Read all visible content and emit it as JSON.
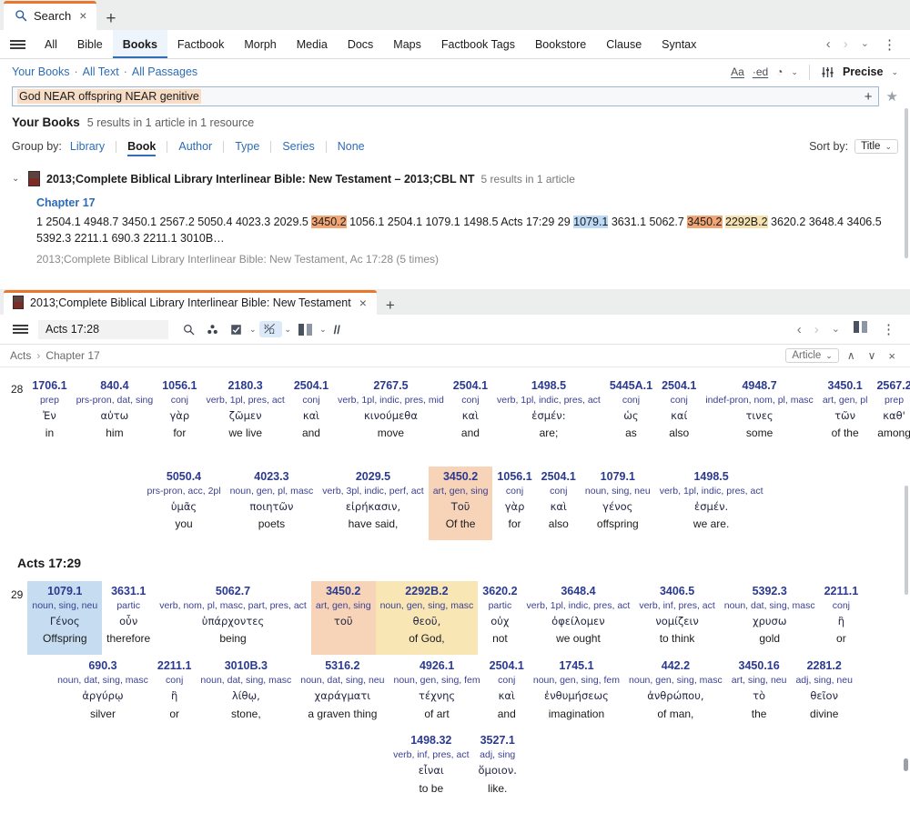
{
  "browser": {
    "tab": {
      "label": "Search",
      "icon": "search-icon",
      "close": "×"
    },
    "new_tab": "+"
  },
  "nav": {
    "menu_icon": "hamburger-icon",
    "items": [
      {
        "label": "All",
        "active": false
      },
      {
        "label": "Bible",
        "active": false
      },
      {
        "label": "Books",
        "active": true
      },
      {
        "label": "Factbook",
        "active": false
      },
      {
        "label": "Morph",
        "active": false
      },
      {
        "label": "Media",
        "active": false
      },
      {
        "label": "Docs",
        "active": false
      },
      {
        "label": "Maps",
        "active": false
      },
      {
        "label": "Factbook Tags",
        "active": false
      },
      {
        "label": "Bookstore",
        "active": false
      },
      {
        "label": "Clause",
        "active": false
      },
      {
        "label": "Syntax",
        "active": false
      }
    ],
    "back": "‹",
    "forward": "›",
    "history_caret": "⌄",
    "kebab": "⋮"
  },
  "breadcrumbs": {
    "items": [
      "Your Books",
      "All Text",
      "All Passages"
    ],
    "separator": "·",
    "tools": {
      "font_size": "Aa",
      "ed_forms": "·ed",
      "history": "◔",
      "history_caret": "⌄",
      "sliders": "♩"
    },
    "match_mode": {
      "label": "Precise",
      "caret": "⌄"
    }
  },
  "search": {
    "query": "God NEAR offspring NEAR genitive",
    "add_button": "+",
    "favorite": "★"
  },
  "results": {
    "title": "Your Books",
    "count": "5 results in 1 article in 1 resource",
    "group_by_label": "Group by:",
    "group_by": [
      {
        "label": "Library",
        "active": false
      },
      {
        "label": "Book",
        "active": true
      },
      {
        "label": "Author",
        "active": false
      },
      {
        "label": "Type",
        "active": false
      },
      {
        "label": "Series",
        "active": false
      },
      {
        "label": "None",
        "active": false
      }
    ],
    "sort_label": "Sort by:",
    "sort_value": "Title",
    "sort_caret": "⌄",
    "book": {
      "expand": "⌄",
      "title": "2013;Complete Biblical Library Interlinear Bible: New Testament – 2013;CBL NT",
      "meta": "5 results in 1 article"
    },
    "chapter_link": "Chapter 17",
    "snippet_parts": [
      {
        "t": "1 2504.1 4948.7 3450.1 2567.2 5050.4 4023.3 2029.5 ",
        "hl": ""
      },
      {
        "t": "3450.2",
        "hl": "orange"
      },
      {
        "t": " 1056.1 2504.1 1079.1 1498.5 Acts 17:29 29 ",
        "hl": ""
      },
      {
        "t": "1079.1",
        "hl": "blue"
      },
      {
        "t": " 3631.1 5062.7 ",
        "hl": ""
      },
      {
        "t": "3450.2",
        "hl": "orange"
      },
      {
        "t": " ",
        "hl": ""
      },
      {
        "t": "2292B.2",
        "hl": "yellow"
      },
      {
        "t": " 3620.2 3648.4 3406.5 5392.3 2211.1 690.3 2211.1 3010B…",
        "hl": ""
      }
    ],
    "snippet_meta": "2013;Complete Biblical Library Interlinear Bible: New Testament, Ac 17:28 (5 times)"
  },
  "panel2": {
    "tab": {
      "label": "2013;Complete Biblical Library Interlinear Bible: New Testament",
      "close": "×"
    },
    "new_tab": "+",
    "menu_icon": "hamburger-icon",
    "reference": "Acts 17:28",
    "toolbar_icons": [
      {
        "name": "search-icon",
        "glyph": "⌕",
        "active": false,
        "caret": ""
      },
      {
        "name": "parallel-resources-icon",
        "glyph": "∴",
        "active": false,
        "caret": ""
      },
      {
        "name": "visual-filters-icon",
        "glyph": "☑",
        "active": false,
        "caret": "⌄"
      },
      {
        "name": "interlinear-icon",
        "glyph": "ℵΩ",
        "active": true,
        "caret": "⌄"
      },
      {
        "name": "columns-icon",
        "glyph": "▐▌",
        "active": false,
        "caret": "⌄"
      },
      {
        "name": "parallel-slashes-icon",
        "glyph": "//",
        "active": false,
        "caret": ""
      }
    ],
    "back": "‹",
    "forward": "›",
    "caret": "⌄",
    "split_icon": "split-panel-icon",
    "kebab": "⋮",
    "breadcrumb": {
      "book": "Acts",
      "arrow": "›",
      "chapter": "Chapter 17"
    },
    "find_scope": "Article",
    "find_caret": "⌄",
    "find_up": "∧",
    "find_down": "∨",
    "find_close": "×"
  },
  "interlinear": {
    "verse28_number": "28",
    "verse29_header": "Acts 17:29",
    "verse29_number": "29",
    "rows": [
      {
        "id": "v28-line1",
        "verse": "28",
        "words": [
          {
            "num": "1706.1",
            "morph": "prep",
            "grk": "Ἐν",
            "eng": "in",
            "hl": ""
          },
          {
            "num": "840.4",
            "morph": "prs-pron, dat, sing",
            "grk": "αὐτω",
            "eng": "him",
            "hl": ""
          },
          {
            "num": "1056.1",
            "morph": "conj",
            "grk": "γὰρ",
            "eng": "for",
            "hl": ""
          },
          {
            "num": "2180.3",
            "morph": "verb, 1pl, pres, act",
            "grk": "ζῶμεν",
            "eng": "we live",
            "hl": ""
          },
          {
            "num": "2504.1",
            "morph": "conj",
            "grk": "καὶ",
            "eng": "and",
            "hl": ""
          },
          {
            "num": "2767.5",
            "morph": "verb, 1pl, indic, pres, mid",
            "grk": "κινούμεθα",
            "eng": "move",
            "hl": ""
          },
          {
            "num": "2504.1",
            "morph": "conj",
            "grk": "καὶ",
            "eng": "and",
            "hl": ""
          },
          {
            "num": "1498.5",
            "morph": "verb, 1pl, indic, pres, act",
            "grk": "ἐσμέν:",
            "eng": "are;",
            "hl": ""
          },
          {
            "num": "5445A.1",
            "morph": "conj",
            "grk": "ὡς",
            "eng": "as",
            "hl": ""
          },
          {
            "num": "2504.1",
            "morph": "conj",
            "grk": "καί",
            "eng": "also",
            "hl": ""
          },
          {
            "num": "4948.7",
            "morph": "indef-pron, nom, pl, masc",
            "grk": "τινες",
            "eng": "some",
            "hl": ""
          },
          {
            "num": "3450.1",
            "morph": "art, gen, pl",
            "grk": "τῶν",
            "eng": "of the",
            "hl": ""
          },
          {
            "num": "2567.2",
            "morph": "prep",
            "grk": "καθ'",
            "eng": "among",
            "hl": ""
          }
        ]
      },
      {
        "id": "v28-line2",
        "verse": "",
        "words": [
          {
            "num": "5050.4",
            "morph": "prs-pron, acc, 2pl",
            "grk": "ὑμᾶς",
            "eng": "you",
            "hl": ""
          },
          {
            "num": "4023.3",
            "morph": "noun, gen, pl, masc",
            "grk": "ποιητῶν",
            "eng": "poets",
            "hl": ""
          },
          {
            "num": "2029.5",
            "morph": "verb, 3pl, indic, perf, act",
            "grk": "εἰρήκασιν,",
            "eng": "have said,",
            "hl": ""
          },
          {
            "num": "3450.2",
            "morph": "art, gen, sing",
            "grk": "Τοῦ",
            "eng": "Of the",
            "hl": "o"
          },
          {
            "num": "1056.1",
            "morph": "conj",
            "grk": "γὰρ",
            "eng": "for",
            "hl": ""
          },
          {
            "num": "2504.1",
            "morph": "conj",
            "grk": "καὶ",
            "eng": "also",
            "hl": ""
          },
          {
            "num": "1079.1",
            "morph": "noun, sing, neu",
            "grk": "γένος",
            "eng": "offspring",
            "hl": ""
          },
          {
            "num": "1498.5",
            "morph": "verb, 1pl, indic, pres, act",
            "grk": "ἐσμέν.",
            "eng": "we are.",
            "hl": ""
          }
        ]
      },
      {
        "id": "v29-line1",
        "verse": "29",
        "words": [
          {
            "num": "1079.1",
            "morph": "noun, sing, neu",
            "grk": "Γένος",
            "eng": "Offspring",
            "hl": "b"
          },
          {
            "num": "3631.1",
            "morph": "partic",
            "grk": "οὖν",
            "eng": "therefore",
            "hl": ""
          },
          {
            "num": "5062.7",
            "morph": "verb, nom, pl, masc, part, pres, act",
            "grk": "ὑπάρχοντες",
            "eng": "being",
            "hl": ""
          },
          {
            "num": "3450.2",
            "morph": "art, gen, sing",
            "grk": "τοῦ",
            "eng": "",
            "hl": "o"
          },
          {
            "num": "2292B.2",
            "morph": "noun, gen, sing, masc",
            "grk": "θεοῦ,",
            "eng": "of God,",
            "hl": "y"
          },
          {
            "num": "3620.2",
            "morph": "partic",
            "grk": "οὐχ",
            "eng": "not",
            "hl": ""
          },
          {
            "num": "3648.4",
            "morph": "verb, 1pl, indic, pres, act",
            "grk": "ὀφείλομεν",
            "eng": "we ought",
            "hl": ""
          },
          {
            "num": "3406.5",
            "morph": "verb, inf, pres, act",
            "grk": "νομίζειν",
            "eng": "to think",
            "hl": ""
          },
          {
            "num": "5392.3",
            "morph": "noun, dat, sing, masc",
            "grk": "χρυσω",
            "eng": "gold",
            "hl": ""
          },
          {
            "num": "2211.1",
            "morph": "conj",
            "grk": "ἢ",
            "eng": "or",
            "hl": ""
          }
        ]
      },
      {
        "id": "v29-line2",
        "verse": "",
        "words": [
          {
            "num": "690.3",
            "morph": "noun, dat, sing, masc",
            "grk": "ἀργύρῳ",
            "eng": "silver",
            "hl": ""
          },
          {
            "num": "2211.1",
            "morph": "conj",
            "grk": "ἢ",
            "eng": "or",
            "hl": ""
          },
          {
            "num": "3010B.3",
            "morph": "noun, dat, sing, masc",
            "grk": "λίθῳ,",
            "eng": "stone,",
            "hl": ""
          },
          {
            "num": "5316.2",
            "morph": "noun, dat, sing, neu",
            "grk": "χαράγματι",
            "eng": "a graven thing",
            "hl": ""
          },
          {
            "num": "4926.1",
            "morph": "noun, gen, sing, fem",
            "grk": "τέχνης",
            "eng": "of art",
            "hl": ""
          },
          {
            "num": "2504.1",
            "morph": "conj",
            "grk": "καὶ",
            "eng": "and",
            "hl": ""
          },
          {
            "num": "1745.1",
            "morph": "noun, gen, sing, fem",
            "grk": "ἐνθυμήσεως",
            "eng": "imagination",
            "hl": ""
          },
          {
            "num": "442.2",
            "morph": "noun, gen, sing, masc",
            "grk": "ἀνθρώπου,",
            "eng": "of man,",
            "hl": ""
          },
          {
            "num": "3450.16",
            "morph": "art, sing, neu",
            "grk": "τὸ",
            "eng": "the",
            "hl": ""
          },
          {
            "num": "2281.2",
            "morph": "adj, sing, neu",
            "grk": "θεῖον",
            "eng": "divine",
            "hl": ""
          }
        ]
      },
      {
        "id": "v29-line3",
        "verse": "",
        "words": [
          {
            "num": "1498.32",
            "morph": "verb, inf, pres, act",
            "grk": "εἶναι",
            "eng": "to be",
            "hl": ""
          },
          {
            "num": "3527.1",
            "morph": "adj, sing",
            "grk": "ὅμοιον.",
            "eng": "like.",
            "hl": ""
          }
        ]
      }
    ]
  },
  "colors": {
    "accent_orange": "#e8762c",
    "link_blue": "#2d6cb5",
    "tab_active_underline": "#2f6fb5",
    "hl_orange": "#f0a675",
    "hl_blue": "#bcd9f5",
    "hl_yellow": "#f5e2b0",
    "greek_ref": "#2b3a8f"
  }
}
